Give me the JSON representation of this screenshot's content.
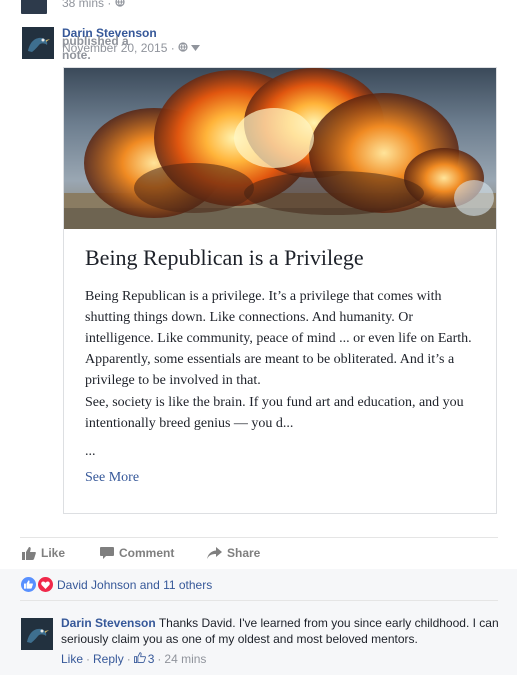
{
  "top_post": {
    "time": "38 mins"
  },
  "post": {
    "author": "Darin Stevenson",
    "action": "published a note.",
    "date": "November 20, 2015"
  },
  "note": {
    "title": "Being Republican is a Privilege",
    "paragraph1": "Being Republican is a privilege. It’s a privilege that comes with shutting things down. Like connections. And humanity. Or intelligence. Like community, peace of mind ... or even life on Earth. Apparently, some essentials are meant to be obliterated. And it’s a privilege to be involved in that.",
    "paragraph2": "See, society is like the brain. If you fund art and education, and you intentionally breed genius — you d...",
    "ellipsis": "...",
    "see_more": "See More"
  },
  "actions": {
    "like": "Like",
    "comment": "Comment",
    "share": "Share"
  },
  "reactions": {
    "summary": "David Johnson and 11 others"
  },
  "comment": {
    "author": "Darin Stevenson",
    "text": "Thanks David. I've learned from you since early childhood. I can seriously claim you as one of my oldest and most beloved mentors.",
    "like": "Like",
    "reply": "Reply",
    "like_count": "3",
    "time": "24 mins"
  },
  "colors": {
    "link": "#365899",
    "meta": "#90949c",
    "like_blue": "#5890ff",
    "love_red": "#f0284a"
  }
}
